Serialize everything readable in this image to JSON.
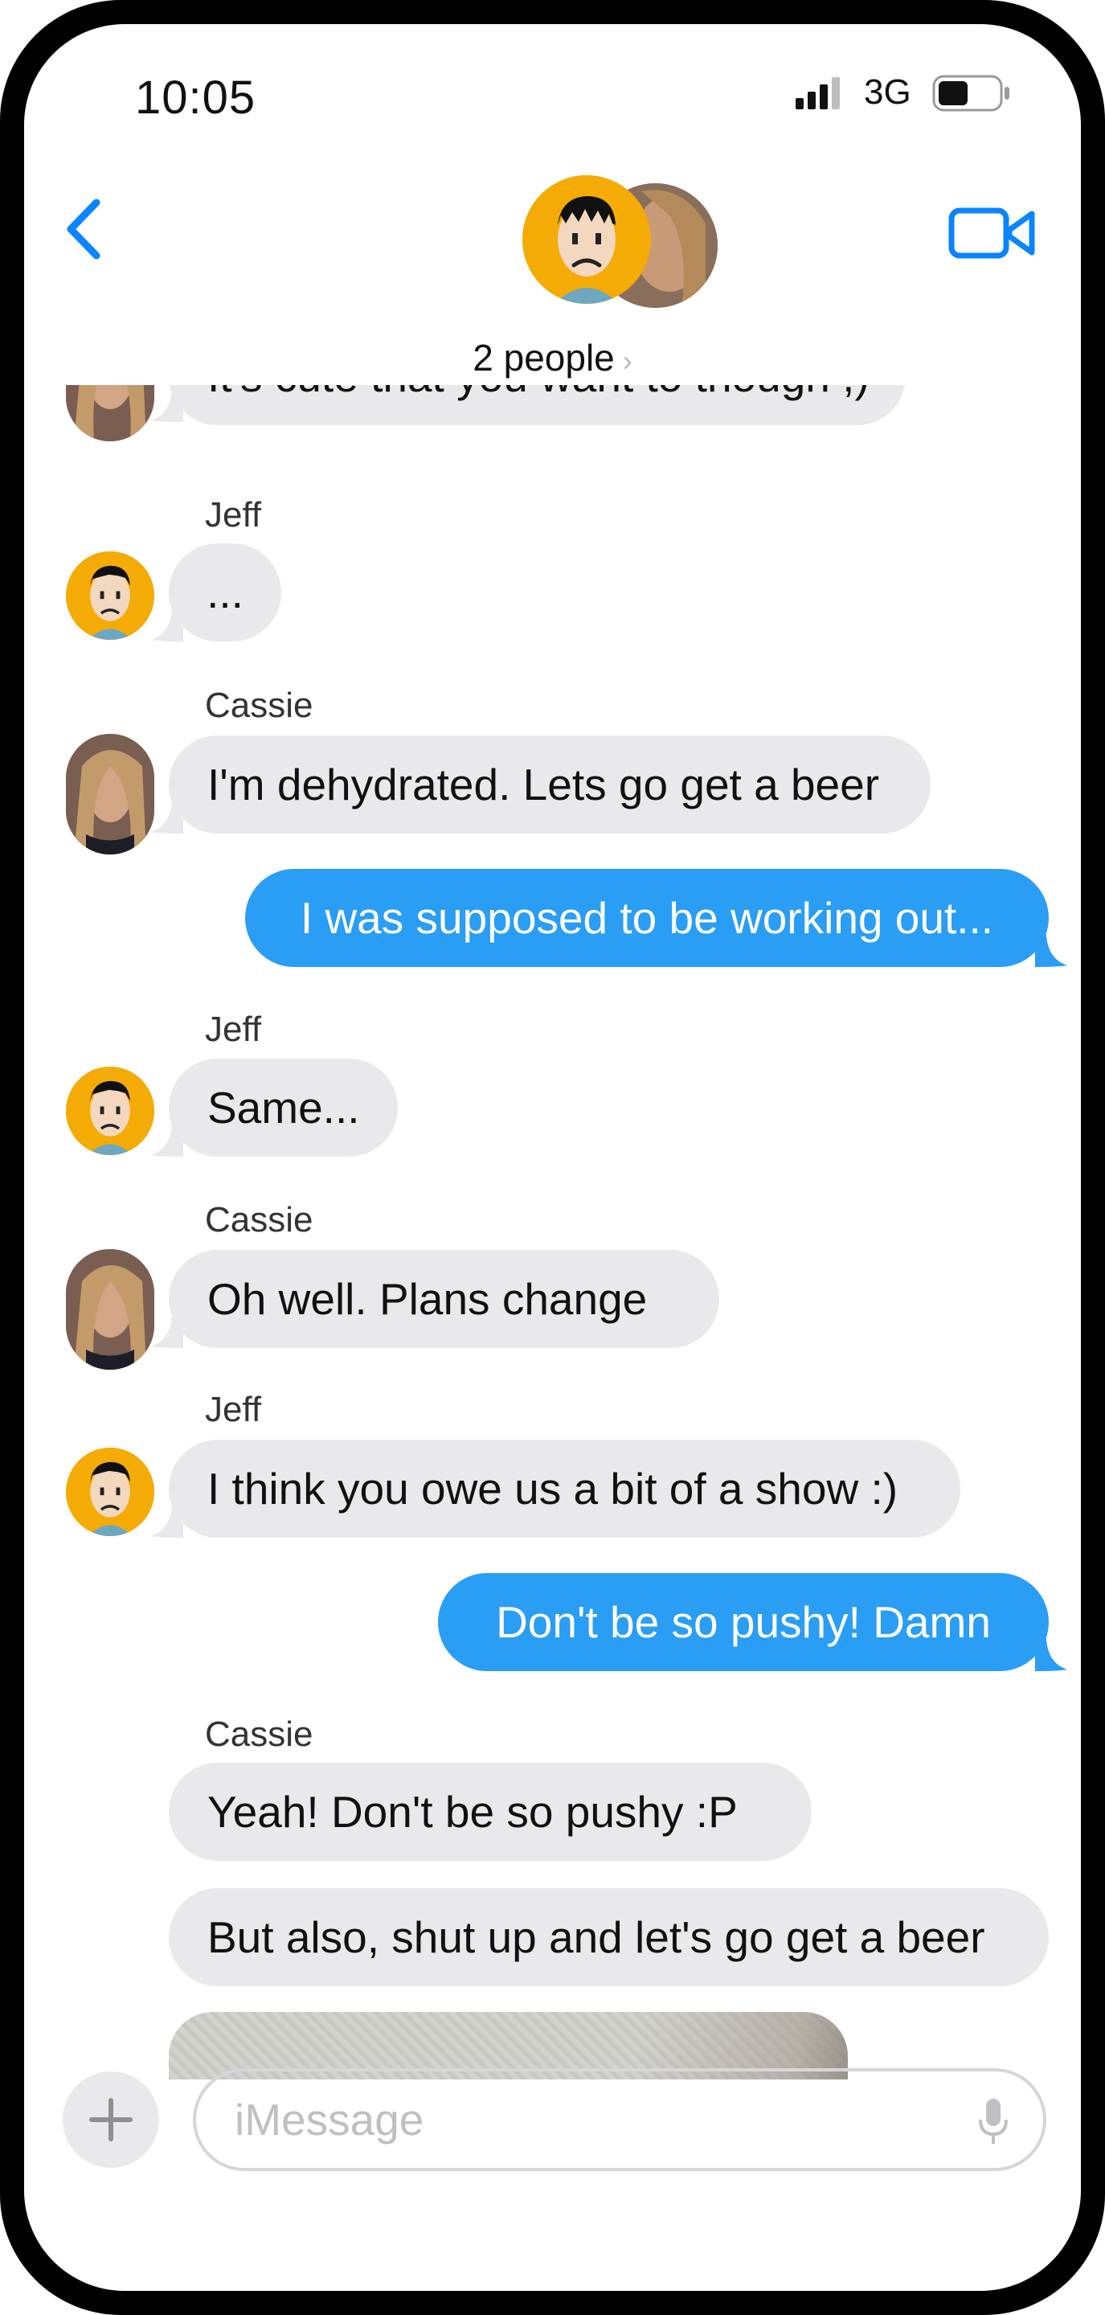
{
  "status_bar": {
    "time": "10:05",
    "network": "3G"
  },
  "header": {
    "participants_label": "2 people",
    "chevron": "›"
  },
  "messages": [
    {
      "id": "m0",
      "text": "It's cute that you want to though ;)"
    },
    {
      "id": "m1",
      "sender": "Jeff",
      "text": "..."
    },
    {
      "id": "m2",
      "sender": "Cassie",
      "text": "I'm dehydrated.  Lets go get a beer"
    },
    {
      "id": "m3",
      "text": "I was supposed to be working out..."
    },
    {
      "id": "m4",
      "sender": "Jeff",
      "text": "Same..."
    },
    {
      "id": "m5",
      "sender": "Cassie",
      "text": "Oh well.  Plans change"
    },
    {
      "id": "m6",
      "sender": "Jeff",
      "text": "I think you owe us a bit of a show :)"
    },
    {
      "id": "m7",
      "text": "Don't be so pushy!  Damn"
    },
    {
      "id": "m8",
      "sender": "Cassie",
      "text": "Yeah!  Don't be so pushy :P"
    },
    {
      "id": "m9",
      "text": "But also, shut up and let's go get a beer"
    }
  ],
  "input": {
    "placeholder": "iMessage"
  },
  "colors": {
    "accent": "#0a84ff",
    "outgoing_bubble": "#2a9df4",
    "incoming_bubble": "#e9e9eb",
    "avatar_bg": "#f4ab06"
  },
  "icons": [
    "back-chevron-icon",
    "video-camera-icon",
    "add-icon",
    "microphone-icon",
    "signal-bars-icon",
    "battery-icon"
  ]
}
